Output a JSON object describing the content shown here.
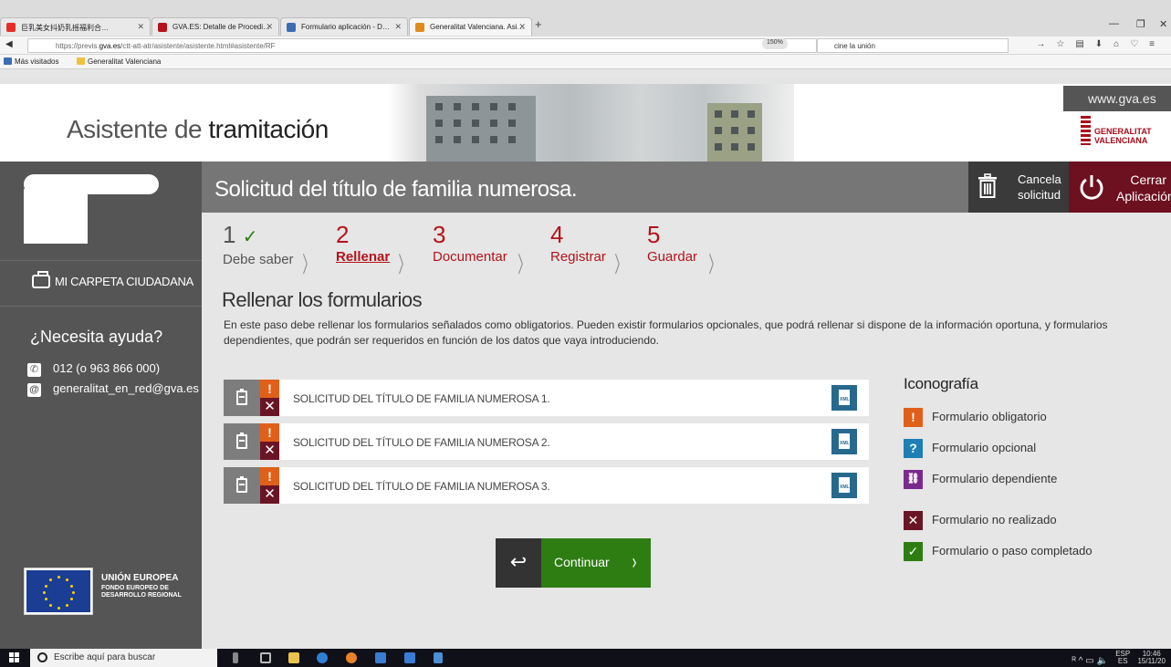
{
  "browser": {
    "tabs": [
      {
        "label": "巨乳美女抖奶乳摇福利合…",
        "icon_color": "#e52d27"
      },
      {
        "label": "GVA.ES: Detalle de Procedi…",
        "icon_color": "#b5121b"
      },
      {
        "label": "Formulario aplicación - D…",
        "icon_color": "#3b6db3"
      },
      {
        "label": "Generalitat Valenciana. Asi…",
        "icon_color": "#e08a1e"
      }
    ],
    "url_prefix": "https://previs.",
    "url_domain": "gva.es",
    "url_path": "/ctt-att-atr/asistente/asistente.html#asistente/RF",
    "zoom": "150%",
    "search_value": "cine la unión",
    "bookmarks": [
      "Más visitados",
      "Generalitat Valenciana"
    ]
  },
  "header": {
    "title_prefix": "Asistente de ",
    "title_bold": "tramitación",
    "gva_link": "www.gva.es",
    "logo_line1": "GENERALITAT",
    "logo_line2": "VALENCIANA"
  },
  "sidebar": {
    "carpeta": "MI CARPETA CIUDADANA",
    "help_title": "¿Necesita ayuda?",
    "phone": "012 (o 963 866 000)",
    "email": "generalitat_en_red@gva.es",
    "eu_title": "UNIÓN EUROPEA",
    "eu_sub1": "FONDO EUROPEO DE",
    "eu_sub2": "DESARROLLO REGIONAL"
  },
  "main": {
    "page_title": "Solicitud del título de familia numerosa.",
    "cancel_line1": "Cancela",
    "cancel_line2": "solicitud",
    "close_line1": "Cerrar",
    "close_line2": "Aplicación",
    "steps": [
      {
        "num": "1",
        "check": "✓",
        "label": "Debe saber"
      },
      {
        "num": "2",
        "label": "Rellenar"
      },
      {
        "num": "3",
        "label": "Documentar"
      },
      {
        "num": "4",
        "label": "Registrar"
      },
      {
        "num": "5",
        "label": "Guardar"
      }
    ],
    "section_title": "Rellenar los formularios",
    "section_desc": "En este paso debe rellenar los formularios señalados como obligatorios. Pueden existir formularios opcionales, que podrá rellenar si dispone de la información oportuna, y formularios dependientes, que podrán ser requeridos en función de los datos que vaya introduciendo.",
    "forms": [
      {
        "name": "SOLICITUD DEL TÍTULO DE FAMILIA NUMEROSA 1.",
        "warn": "!",
        "status": "✕",
        "xml": "XML"
      },
      {
        "name": "SOLICITUD DEL TÍTULO DE FAMILIA NUMEROSA 2.",
        "warn": "!",
        "status": "✕",
        "xml": "XML"
      },
      {
        "name": "SOLICITUD DEL TÍTULO DE FAMILIA NUMEROSA 3.",
        "warn": "!",
        "status": "✕",
        "xml": "XML"
      }
    ],
    "legend_title": "Iconografía",
    "legend": [
      {
        "icon": "!",
        "label": "Formulario obligatorio",
        "color": "#e0601a"
      },
      {
        "icon": "?",
        "label": "Formulario opcional",
        "color": "#1e7fb5"
      },
      {
        "icon": "🔗",
        "label": "Formulario dependiente",
        "color": "#7a2a8c"
      },
      {
        "icon": "✕",
        "label": "Formulario no realizado",
        "color": "#6a1525"
      },
      {
        "icon": "✓",
        "label": "Formulario o paso completado",
        "color": "#2e7d12"
      }
    ],
    "back_icon": "↩",
    "continue_label": "Continuar",
    "continue_arrow": "›"
  },
  "taskbar": {
    "search_placeholder": "Escribe aquí para buscar",
    "lang": "ESP",
    "lang2": "ES",
    "time": "10:46",
    "date": "15/11/20"
  },
  "colors": {
    "accent_red": "#b3131b",
    "step_gray": "#555555",
    "check_green": "#2e7d12"
  }
}
